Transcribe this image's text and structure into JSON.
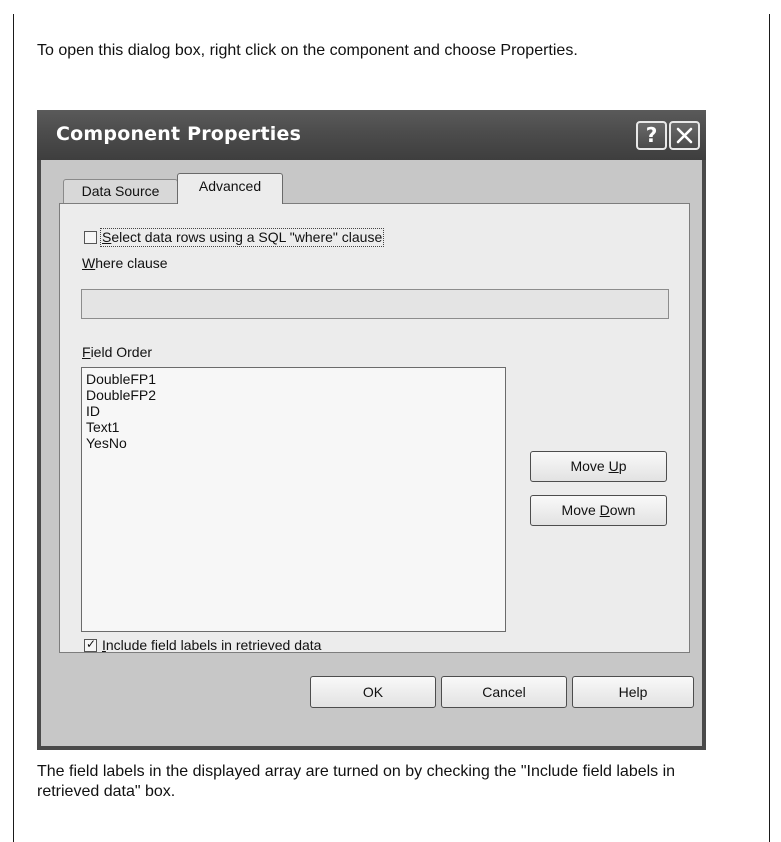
{
  "captions": {
    "top": "To open this dialog box, right click on the component and choose Properties.",
    "bottom": "The field labels in the displayed array are turned on by checking the \"Include field labels in retrieved data\" box."
  },
  "dialog": {
    "title": "Component Properties",
    "help_glyph": "?",
    "tabs": [
      {
        "label": "Data Source",
        "selected": false
      },
      {
        "label": "Advanced",
        "selected": true
      }
    ],
    "sql_where": {
      "checked": false,
      "accesskey": "S",
      "label_rest": "elect data rows using a SQL \"where\" clause"
    },
    "where_clause": {
      "accesskey": "W",
      "label_rest": "here clause",
      "value": ""
    },
    "field_order": {
      "accesskey": "F",
      "label_rest": "ield Order",
      "items": [
        "DoubleFP1",
        "DoubleFP2",
        "ID",
        "Text1",
        "YesNo"
      ]
    },
    "move_up": {
      "prefix": "Move ",
      "accesskey": "U",
      "suffix": "p"
    },
    "move_down": {
      "prefix": "Move ",
      "accesskey": "D",
      "suffix": "own"
    },
    "include_labels": {
      "checked": true,
      "check_glyph": "✓",
      "accesskey": "I",
      "label_rest": "nclude field labels in retrieved data"
    },
    "buttons": {
      "ok": "OK",
      "cancel": "Cancel",
      "help": "Help"
    }
  },
  "icons": {
    "help": "help-question-icon",
    "close": "close-x-icon",
    "checkmark": "checkmark-icon"
  }
}
